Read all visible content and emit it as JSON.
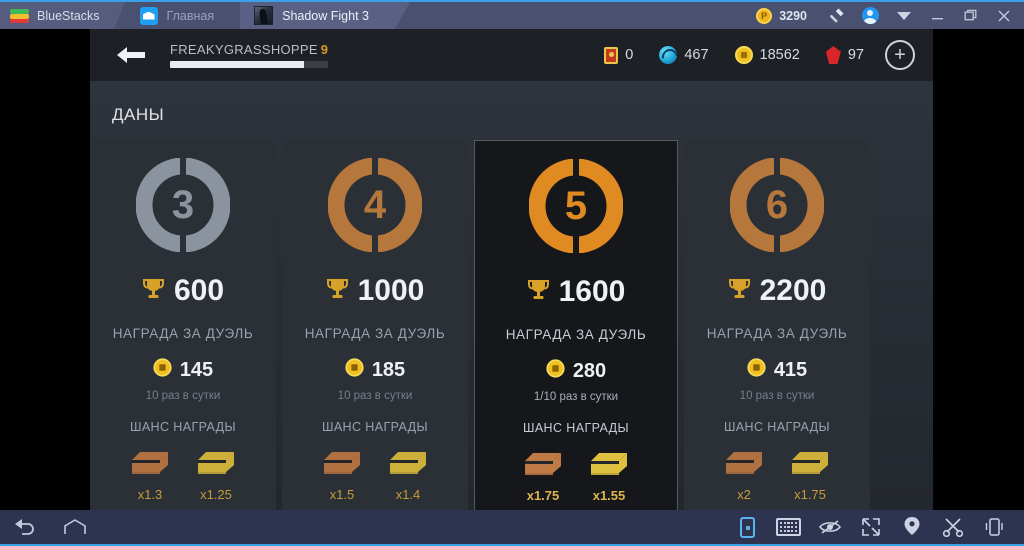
{
  "titlebar": {
    "brand": "BlueStacks",
    "tabs": [
      {
        "label": "Главная",
        "icon": "home-icon",
        "active": false
      },
      {
        "label": "Shadow Fight 3",
        "icon": "game-thumbnail-icon",
        "active": true
      }
    ],
    "points": "3290",
    "points_icon": "bluestacks-points-icon",
    "tools_icon": "hammer-icon",
    "avatar_icon": "user-avatar-icon",
    "more_icon": "chevron-down-icon",
    "minimize_label": "—",
    "maximize_label": "❐",
    "close_label": "✕"
  },
  "game": {
    "back_icon": "back-arrow-icon",
    "player": {
      "name": "FREAKYGRASSHOPPE",
      "level": "9",
      "xp_percent": 85
    },
    "resources": [
      {
        "name": "tickets",
        "icon": "ticket-icon",
        "value": "0"
      },
      {
        "name": "energy",
        "icon": "energy-orb-icon",
        "value": "467"
      },
      {
        "name": "gold",
        "icon": "gold-coin-icon",
        "value": "18562"
      },
      {
        "name": "gems",
        "icon": "gem-icon",
        "value": "97"
      }
    ],
    "add_button": "+",
    "section_title": "ДАНЫ",
    "cards": [
      {
        "rank": "3",
        "color": "#8b939e",
        "selected": false,
        "trophies": "600",
        "trophy_icon": "trophy-icon",
        "duel_label": "НАГРАДА ЗА ДУЭЛЬ",
        "coin_icon": "gold-coin-icon",
        "coins": "145",
        "per_day": "10 раз в сутки",
        "chance_label": "ШАНС НАГРАДЫ",
        "chests": [
          {
            "icon": "bronze-chest-icon",
            "color": "#b0703f",
            "mult": "x1.3"
          },
          {
            "icon": "gold-chest-icon",
            "color": "#ccb03a",
            "mult": "x1.25"
          }
        ]
      },
      {
        "rank": "4",
        "color": "#b5773c",
        "selected": false,
        "trophies": "1000",
        "trophy_icon": "trophy-icon",
        "duel_label": "НАГРАДА ЗА ДУЭЛЬ",
        "coin_icon": "gold-coin-icon",
        "coins": "185",
        "per_day": "10 раз в сутки",
        "chance_label": "ШАНС НАГРАДЫ",
        "chests": [
          {
            "icon": "bronze-chest-icon",
            "color": "#b0703f",
            "mult": "x1.5"
          },
          {
            "icon": "gold-chest-icon",
            "color": "#ccb03a",
            "mult": "x1.4"
          }
        ]
      },
      {
        "rank": "5",
        "color": "#e08a22",
        "selected": true,
        "trophies": "1600",
        "trophy_icon": "trophy-icon",
        "duel_label": "НАГРАДА ЗА ДУЭЛЬ",
        "coin_icon": "gold-coin-icon",
        "coins": "280",
        "per_day": "1/10 раз в сутки",
        "chance_label": "ШАНС НАГРАДЫ",
        "chests": [
          {
            "icon": "bronze-chest-icon",
            "color": "#c07a45",
            "mult": "x1.75"
          },
          {
            "icon": "gold-chest-icon",
            "color": "#ddc040",
            "mult": "x1.55"
          }
        ]
      },
      {
        "rank": "6",
        "color": "#b5773c",
        "selected": false,
        "trophies": "2200",
        "trophy_icon": "trophy-icon",
        "duel_label": "НАГРАДА ЗА ДУЭЛЬ",
        "coin_icon": "gold-coin-icon",
        "coins": "415",
        "per_day": "10 раз в сутки",
        "chance_label": "ШАНС НАГРАДЫ",
        "chests": [
          {
            "icon": "bronze-chest-icon",
            "color": "#b0703f",
            "mult": "x2"
          },
          {
            "icon": "gold-chest-icon",
            "color": "#ccb03a",
            "mult": "x1.75"
          }
        ]
      }
    ]
  },
  "bottombar": {
    "back_icon": "android-back-icon",
    "home_icon": "android-home-icon",
    "tools": [
      {
        "icon": "keymapping-icon",
        "active": true
      },
      {
        "icon": "keyboard-icon",
        "active": false
      },
      {
        "icon": "eye-slash-icon",
        "active": false
      },
      {
        "icon": "fullscreen-icon",
        "active": false
      },
      {
        "icon": "location-pin-icon",
        "active": false
      },
      {
        "icon": "scissors-screenshot-icon",
        "active": false
      },
      {
        "icon": "shake-device-icon",
        "active": false
      }
    ]
  }
}
